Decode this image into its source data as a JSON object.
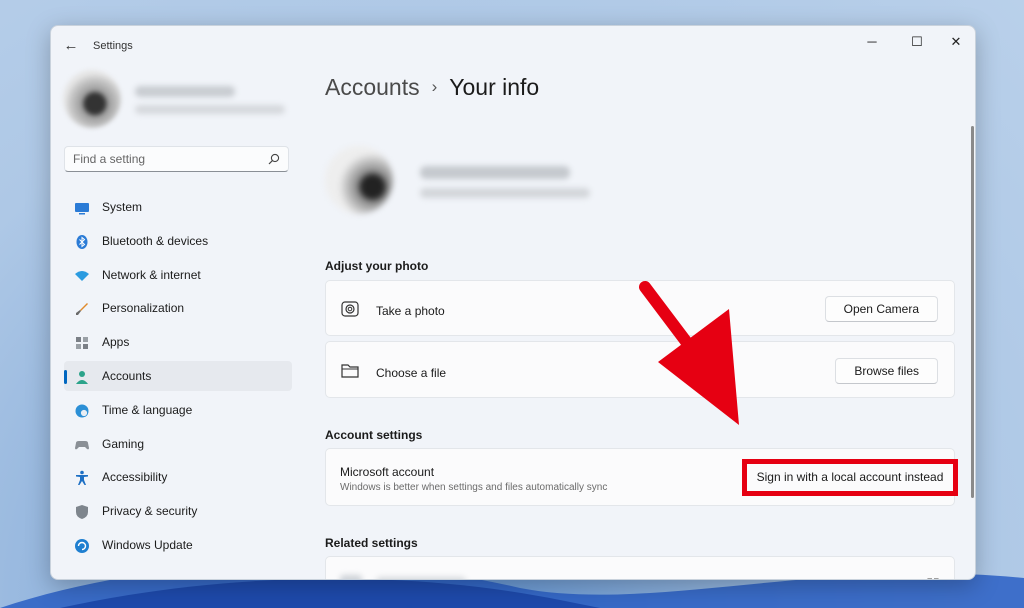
{
  "window": {
    "app_title": "Settings",
    "controls": {
      "minimize": "─",
      "maximize": "☐",
      "close": "✕"
    }
  },
  "sidebar": {
    "search": {
      "placeholder": "Find a setting"
    },
    "items": [
      {
        "label": "System",
        "icon": "system-icon"
      },
      {
        "label": "Bluetooth & devices",
        "icon": "bluetooth-icon"
      },
      {
        "label": "Network & internet",
        "icon": "wifi-icon"
      },
      {
        "label": "Personalization",
        "icon": "brush-icon"
      },
      {
        "label": "Apps",
        "icon": "apps-icon"
      },
      {
        "label": "Accounts",
        "icon": "person-icon",
        "active": true
      },
      {
        "label": "Time & language",
        "icon": "globe-clock-icon"
      },
      {
        "label": "Gaming",
        "icon": "gamepad-icon"
      },
      {
        "label": "Accessibility",
        "icon": "accessibility-icon"
      },
      {
        "label": "Privacy & security",
        "icon": "shield-icon"
      },
      {
        "label": "Windows Update",
        "icon": "update-icon"
      }
    ]
  },
  "main": {
    "breadcrumb": {
      "parent": "Accounts",
      "separator": "›",
      "current": "Your info"
    },
    "adjust_photo": {
      "heading": "Adjust your photo",
      "take_photo": {
        "label": "Take a photo",
        "button": "Open Camera",
        "icon": "camera-icon"
      },
      "choose_file": {
        "label": "Choose a file",
        "button": "Browse files",
        "icon": "folder-icon"
      }
    },
    "account_settings": {
      "heading": "Account settings",
      "microsoft_account": {
        "title": "Microsoft account",
        "subtitle": "Windows is better when settings and files automatically sync",
        "button": "Sign in with a local account instead"
      }
    },
    "related_settings": {
      "heading": "Related settings",
      "icon": "external-link-icon"
    }
  },
  "colors": {
    "accent": "#0067c0",
    "highlight": "#e60012"
  }
}
